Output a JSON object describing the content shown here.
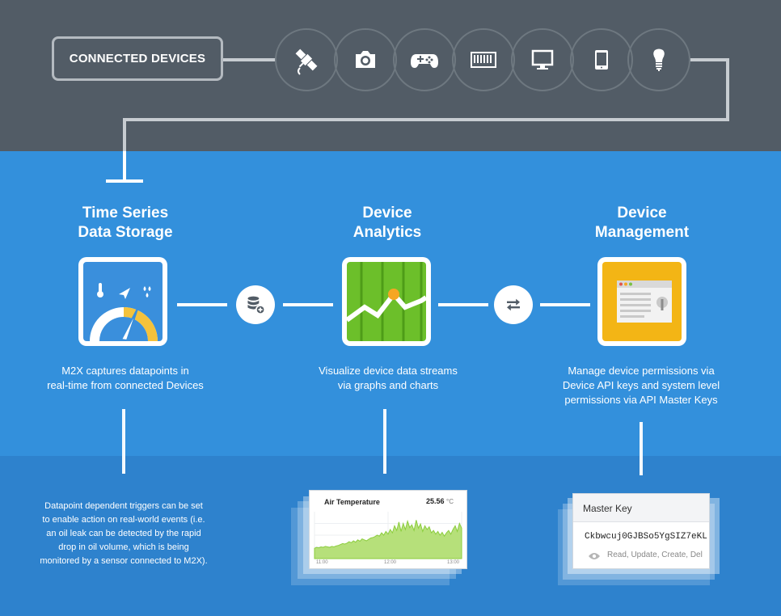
{
  "header": {
    "connected_devices_label": "CONNECTED DEVICES"
  },
  "devices": [
    {
      "icon": "satellite-icon"
    },
    {
      "icon": "camera-icon"
    },
    {
      "icon": "gamepad-icon"
    },
    {
      "icon": "keyboard-icon"
    },
    {
      "icon": "monitor-icon"
    },
    {
      "icon": "tablet-icon"
    },
    {
      "icon": "lightbulb-icon"
    }
  ],
  "sections": {
    "storage": {
      "title_line1": "Time Series",
      "title_line2": "Data Storage",
      "description_line1": "M2X captures datapoints in",
      "description_line2": "real-time from connected Devices"
    },
    "analytics": {
      "title_line1": "Device",
      "title_line2": "Analytics",
      "description_line1": "Visualize device data streams",
      "description_line2": "via graphs and charts"
    },
    "management": {
      "title_line1": "Device",
      "title_line2": "Management",
      "description_line1": "Manage device permissions via",
      "description_line2": "Device API keys and system level",
      "description_line3": "permissions via API Master Keys"
    }
  },
  "triggers": {
    "line1": "Datapoint dependent triggers can be set",
    "line2": "to enable action on real-world events (i.e.",
    "line3": "an oil leak can be detected by the rapid",
    "line4": "drop in oil volume, which is being",
    "line5": "monitored by a sensor connected to M2X)."
  },
  "chart_card": {
    "title": "Air Temperature",
    "value": "25.56",
    "unit": "°C",
    "x_ticks": [
      "11:00",
      "12:00",
      "13:00"
    ]
  },
  "master_key_card": {
    "title": "Master Key",
    "key": "Ckbwcuj0GJBSo5YgSIZ7eKL",
    "permissions": "Read, Update, Create, Del"
  },
  "chart_data": {
    "type": "area",
    "title": "Air Temperature",
    "x_ticks": [
      "11:00",
      "12:00",
      "13:00"
    ],
    "values": [
      0.22,
      0.24,
      0.23,
      0.25,
      0.24,
      0.26,
      0.25,
      0.24,
      0.26,
      0.25,
      0.27,
      0.28,
      0.3,
      0.32,
      0.31,
      0.33,
      0.36,
      0.34,
      0.38,
      0.35,
      0.4,
      0.37,
      0.42,
      0.4,
      0.38,
      0.41,
      0.44,
      0.45,
      0.47,
      0.5,
      0.48,
      0.55,
      0.5,
      0.58,
      0.52,
      0.62,
      0.55,
      0.7,
      0.6,
      0.78,
      0.58,
      0.75,
      0.62,
      0.8,
      0.66,
      0.72,
      0.6,
      0.82,
      0.65,
      0.74,
      0.58,
      0.7,
      0.62,
      0.68,
      0.55,
      0.6,
      0.52,
      0.58,
      0.5,
      0.56,
      0.48,
      0.55,
      0.6,
      0.52,
      0.62,
      0.7,
      0.58,
      0.75,
      0.65
    ]
  },
  "colors": {
    "header_bg": "#525c66",
    "main_bg": "#3390dc",
    "analytics_green": "#6cbf2a",
    "storage_blue": "#3a8fdc",
    "management_yellow": "#f3b515",
    "gauge_yellow": "#f4c23c",
    "chart_dot_orange": "#f5a623"
  }
}
